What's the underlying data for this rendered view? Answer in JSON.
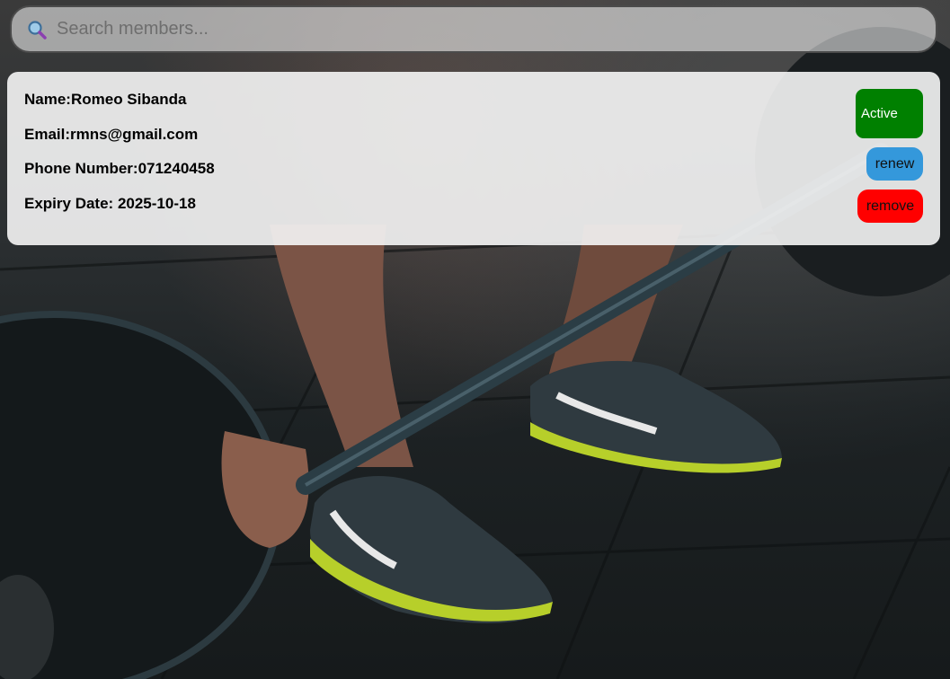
{
  "search": {
    "placeholder": "Search members...",
    "value": "",
    "icon": "search-icon"
  },
  "member": {
    "name_label": "Name:",
    "name": "Romeo Sibanda",
    "email_label": "Email:",
    "email": "rmns@gmail.com",
    "phone_label": "Phone Number:",
    "phone": "071240458",
    "expiry_label": "Expiry Date: ",
    "expiry": "2025-10-18",
    "status_label": "Active",
    "renew_label": "renew",
    "remove_label": "remove"
  },
  "colors": {
    "status_active": "#008000",
    "renew": "#3498db",
    "remove": "#ff0000"
  }
}
